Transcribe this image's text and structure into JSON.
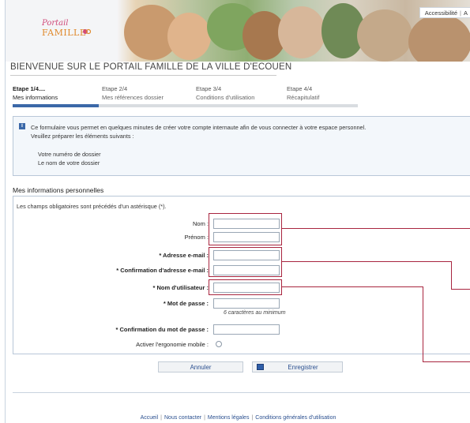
{
  "header": {
    "logo_line1": "Portail",
    "logo_line2": "FAMILLE",
    "top_links": [
      "Accessibilité",
      "A"
    ]
  },
  "welcome_title": "BIENVENUE SUR LE PORTAIL FAMILLE DE LA VILLE D'ECOUEN",
  "steps": {
    "progress": 0.25,
    "items": [
      {
        "title": "Etape 1/4....",
        "subtitle": "Mes informations"
      },
      {
        "title": "Etape 2/4",
        "subtitle": "Mes références dossier"
      },
      {
        "title": "Etape 3/4",
        "subtitle": "Conditions d'utilisation"
      },
      {
        "title": "Etape 4/4",
        "subtitle": "Récapitulatif"
      }
    ]
  },
  "info": {
    "line1": "Ce formulaire vous permet en quelques minutes de créer votre compte internaute afin de vous connecter à votre espace personnel.",
    "line2": "Veuillez préparer les éléments suivants :",
    "items": [
      "Votre numéro de dossier",
      "Le nom de votre dossier"
    ]
  },
  "form": {
    "section_title": "Mes informations personnelles",
    "required_note": "Les champs obligatoires sont précédés d'un astérisque (*).",
    "fields": {
      "nom": {
        "label": "Nom :",
        "value": ""
      },
      "prenom": {
        "label": "Prénom :",
        "value": ""
      },
      "email": {
        "label": "* Adresse e-mail :",
        "value": ""
      },
      "email_confirm": {
        "label": "* Confirmation d'adresse e-mail :",
        "value": ""
      },
      "username": {
        "label": "* Nom d'utilisateur :",
        "value": ""
      },
      "password": {
        "label": "* Mot de passe :",
        "value": ""
      },
      "password_confirm": {
        "label": "* Confirmation du mot de passe :",
        "value": ""
      }
    },
    "password_hint": "6 caractères au minimum",
    "mobile_label": "Activer l'ergonomie mobile :",
    "cancel_label": "Annuler",
    "save_label": "Enregistrer"
  },
  "footer": {
    "links": [
      "Accueil",
      "Nous contacter",
      "Mentions légales",
      "Conditions générales d'utilisation"
    ]
  },
  "colors": {
    "accent": "#3b68a8",
    "annotation": "#a8253f"
  }
}
